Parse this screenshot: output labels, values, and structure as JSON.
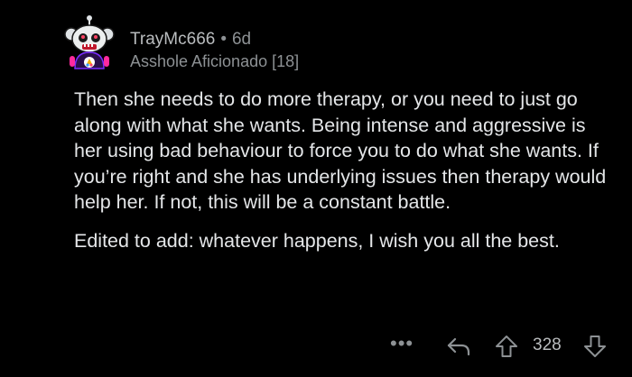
{
  "comment": {
    "author": "TrayMc666",
    "separator": "•",
    "age": "6d",
    "flair": "Asshole Aficionado [18]",
    "paragraphs": [
      "Then she needs to do more therapy, or you need to just go along with what she wants. Being intense and aggressive is her using bad behaviour to force you to do what she wants. If you’re right and she has underlying issues then therapy would help her. If not, this will be a constant battle.",
      "Edited to add: whatever happens, I wish you all the best."
    ]
  },
  "actions": {
    "more": "•••",
    "score": "328"
  },
  "icons": {
    "avatar": "snoo-avatar-icon",
    "more": "more-options-icon",
    "reply": "reply-icon",
    "upvote": "upvote-arrow-icon",
    "downvote": "downvote-arrow-icon"
  },
  "colors": {
    "background": "#000000",
    "text": "#e4e6e8",
    "muted": "#8d9194"
  }
}
